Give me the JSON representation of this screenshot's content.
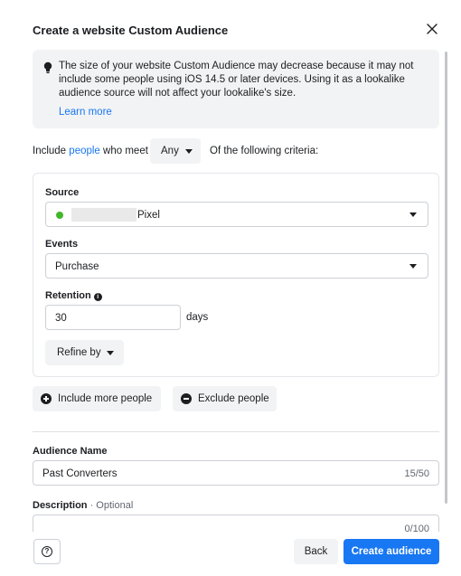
{
  "dialog": {
    "title": "Create a website Custom Audience"
  },
  "notice": {
    "text": "The size of your website Custom Audience may decrease because it may not include some people using iOS 14.5 or later devices. Using it as a lookalike audience source will not affect your lookalike's size.",
    "link": "Learn more"
  },
  "criteria": {
    "prefix": "Include",
    "people_link": "people",
    "middle": "who meet",
    "match": "Any",
    "suffix": "Of the following criteria:"
  },
  "rule": {
    "source_label": "Source",
    "source_value": "Pixel",
    "source_status_color": "#42b72a",
    "events_label": "Events",
    "events_value": "Purchase",
    "retention_label": "Retention",
    "retention_value": "30",
    "retention_unit": "days",
    "refine_label": "Refine by"
  },
  "actions": {
    "include_more": "Include more people",
    "exclude": "Exclude people"
  },
  "audience_name": {
    "label": "Audience Name",
    "value": "Past Converters",
    "counter": "15/50"
  },
  "description": {
    "label": "Description",
    "optional": "· Optional",
    "value": "",
    "counter": "0/100"
  },
  "footer": {
    "help": "?",
    "back": "Back",
    "create": "Create audience"
  },
  "colors": {
    "primary": "#1877f2",
    "link": "#1877f2"
  }
}
